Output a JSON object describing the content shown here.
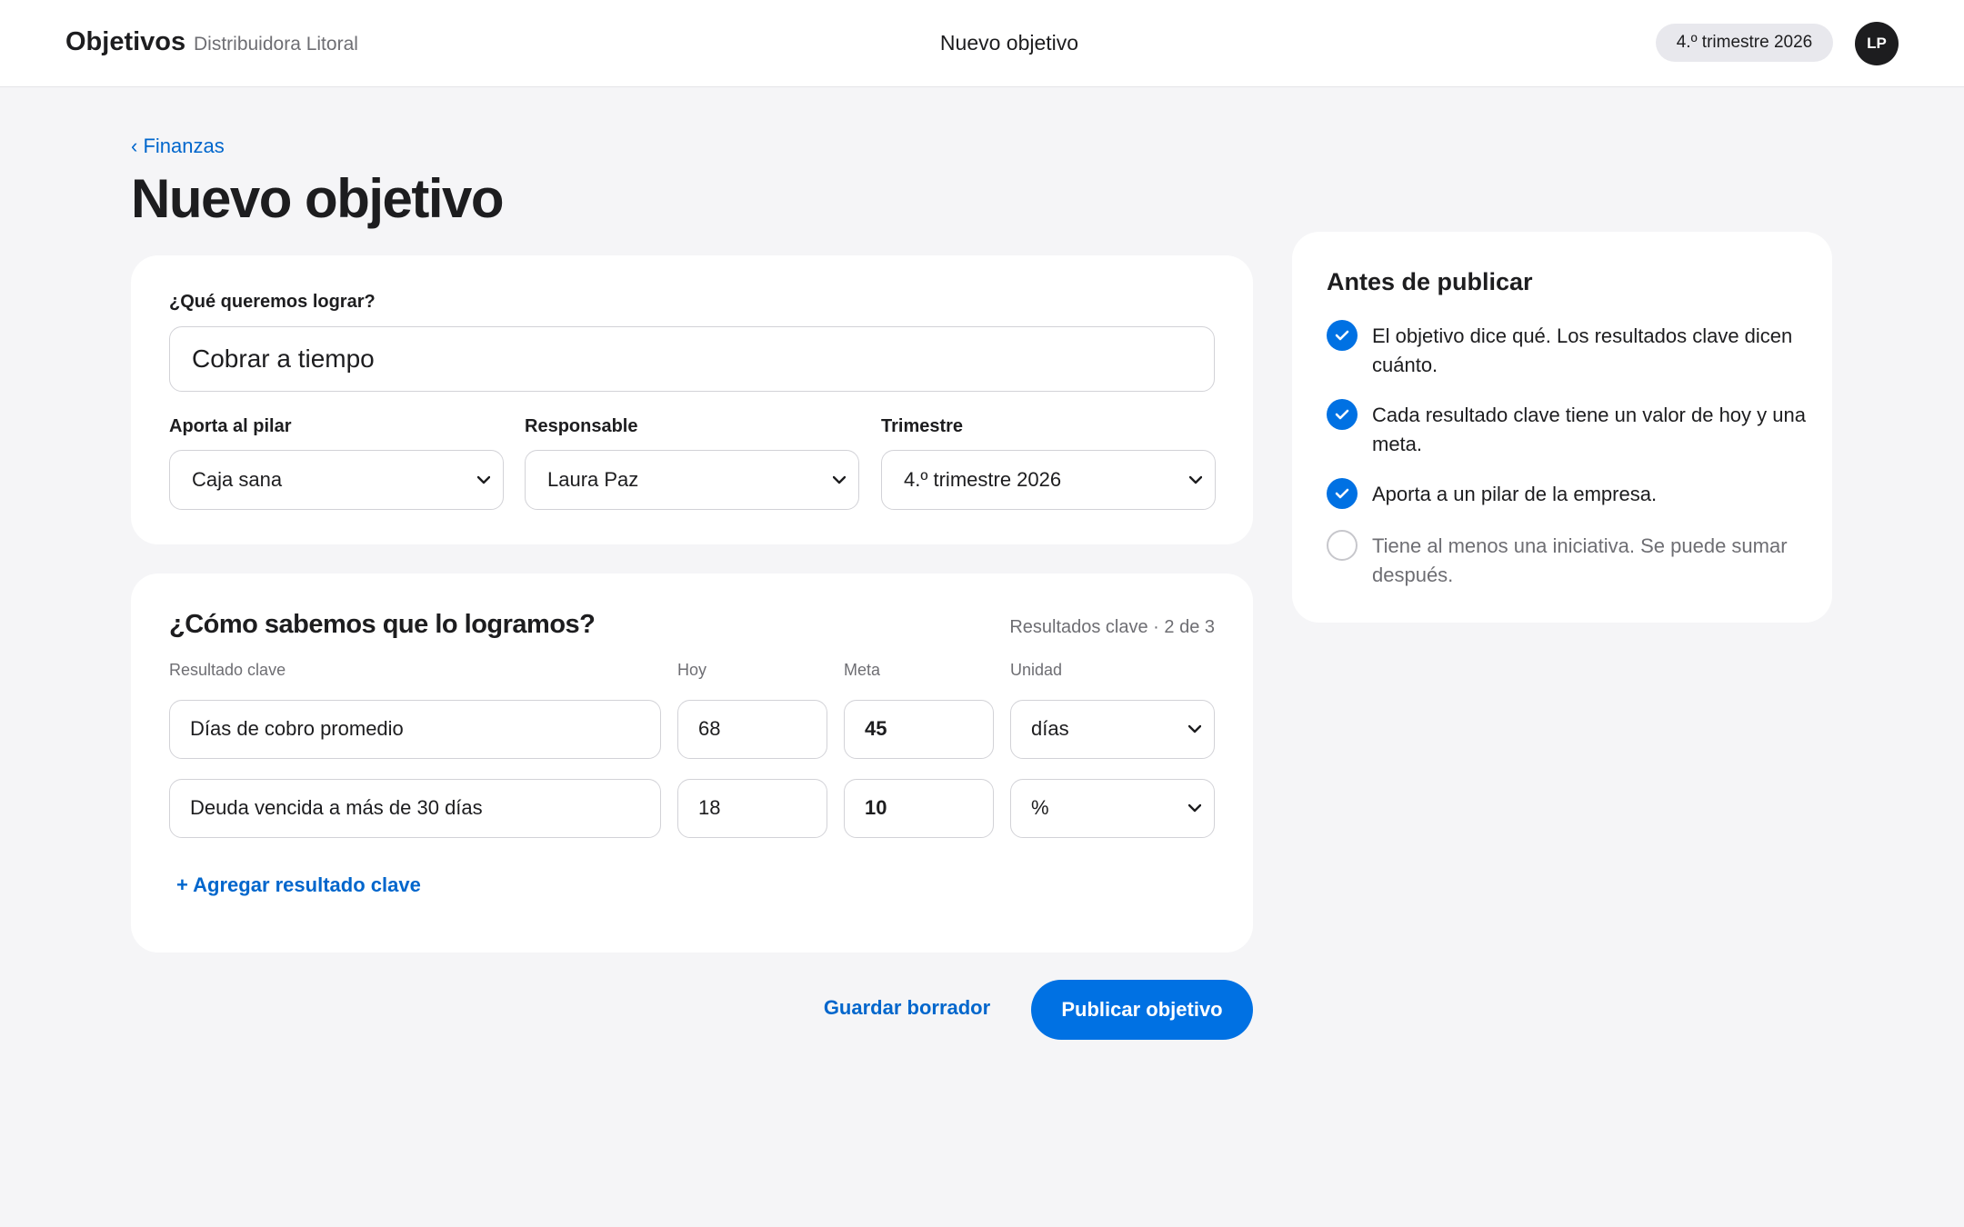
{
  "header": {
    "app_name": "Objetivos",
    "company": "Distribuidora Litoral",
    "title": "Nuevo objetivo",
    "quarter_badge": "4.º trimestre 2026",
    "user_initials": "LP"
  },
  "page": {
    "back_link": "‹ Finanzas",
    "title": "Nuevo objetivo"
  },
  "goal": {
    "question_label": "¿Qué queremos lograr?",
    "value": "Cobrar a tiempo",
    "pillar_label": "Aporta al pilar",
    "pillar_value": "Caja sana",
    "owner_label": "Responsable",
    "owner_value": "Laura Paz",
    "quarter_label": "Trimestre",
    "quarter_value": "4.º trimestre 2026"
  },
  "key_results": {
    "title": "¿Cómo sabemos que lo logramos?",
    "count": "Resultados clave · 2 de 3",
    "columns": {
      "name": "Resultado clave",
      "today": "Hoy",
      "target": "Meta",
      "unit": "Unidad"
    },
    "rows": [
      {
        "name": "Días de cobro promedio",
        "today": "68",
        "target": "45",
        "unit": "días"
      },
      {
        "name": "Deuda vencida a más de 30 días",
        "today": "18",
        "target": "10",
        "unit": "%"
      }
    ],
    "add_label": "+ Agregar resultado clave"
  },
  "actions": {
    "save_draft": "Guardar borrador",
    "publish": "Publicar objetivo"
  },
  "checklist": {
    "title": "Antes de publicar",
    "items": [
      {
        "text": "El objetivo dice qué. Los resultados clave dicen cuánto.",
        "done": true
      },
      {
        "text": "Cada resultado clave tiene un valor de hoy y una meta.",
        "done": true
      },
      {
        "text": "Aporta a un pilar de la empresa.",
        "done": true
      },
      {
        "text": "Tiene al menos una iniciativa. Se puede sumar después.",
        "done": false
      }
    ]
  },
  "colors": {
    "accent": "#0071e3",
    "link": "#0066cc",
    "background": "#f5f5f7"
  }
}
